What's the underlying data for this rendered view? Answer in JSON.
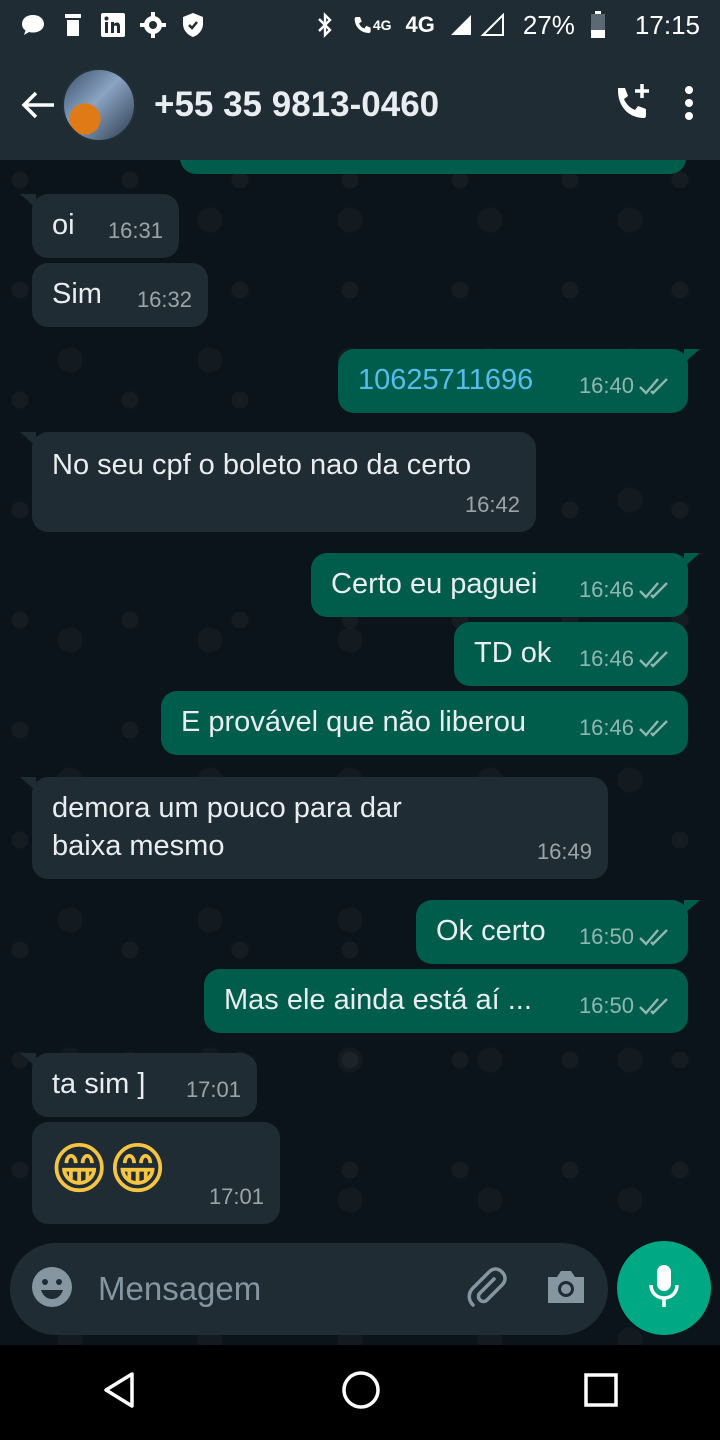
{
  "status_bar": {
    "network_type": "4G",
    "volte_label": "4G",
    "battery": "27%",
    "time": "17:15",
    "left_icons": [
      "chat-bubble-icon",
      "trash-icon",
      "linkedin-icon",
      "settings-gear-icon",
      "shield-icon"
    ],
    "right_icons": [
      "bluetooth-icon",
      "volte-call-icon",
      "signal-icon",
      "battery-icon"
    ]
  },
  "header": {
    "contact": "+55 35 9813-0460",
    "icons": [
      "back-arrow-icon",
      "add-call-icon",
      "more-vert-icon"
    ]
  },
  "messages": [
    {
      "dir": "in",
      "text": "oi",
      "time": "16:31"
    },
    {
      "dir": "in",
      "text": "Sim",
      "time": "16:32"
    },
    {
      "dir": "out",
      "text": "10625711696",
      "time": "16:40",
      "style": "link"
    },
    {
      "dir": "in",
      "text": "No seu cpf o boleto nao da certo",
      "time": "16:42"
    },
    {
      "dir": "out",
      "text": "Certo eu paguei",
      "time": "16:46"
    },
    {
      "dir": "out",
      "text": "TD ok",
      "time": "16:46"
    },
    {
      "dir": "out",
      "text": "E provável que não liberou",
      "time": "16:46"
    },
    {
      "dir": "in",
      "text": "demora um pouco para dar\nbaixa mesmo",
      "time": "16:49"
    },
    {
      "dir": "out",
      "text": "Ok certo",
      "time": "16:50"
    },
    {
      "dir": "out",
      "text": "Mas ele ainda está aí ...",
      "time": "16:50"
    },
    {
      "dir": "in",
      "text": "ta sim ]",
      "time": "17:01"
    },
    {
      "dir": "in",
      "text": "😁😁",
      "time": "17:01",
      "style": "emoji"
    }
  ],
  "composer": {
    "placeholder": "Mensagem",
    "icons": [
      "emoji-icon",
      "attach-icon",
      "camera-icon",
      "mic-icon"
    ]
  },
  "colors": {
    "background": "#0b141a",
    "bar": "#1f2c34",
    "incoming": "#1f2c34",
    "outgoing": "#005c4b",
    "accent": "#00a884",
    "link": "#53bdeb"
  }
}
